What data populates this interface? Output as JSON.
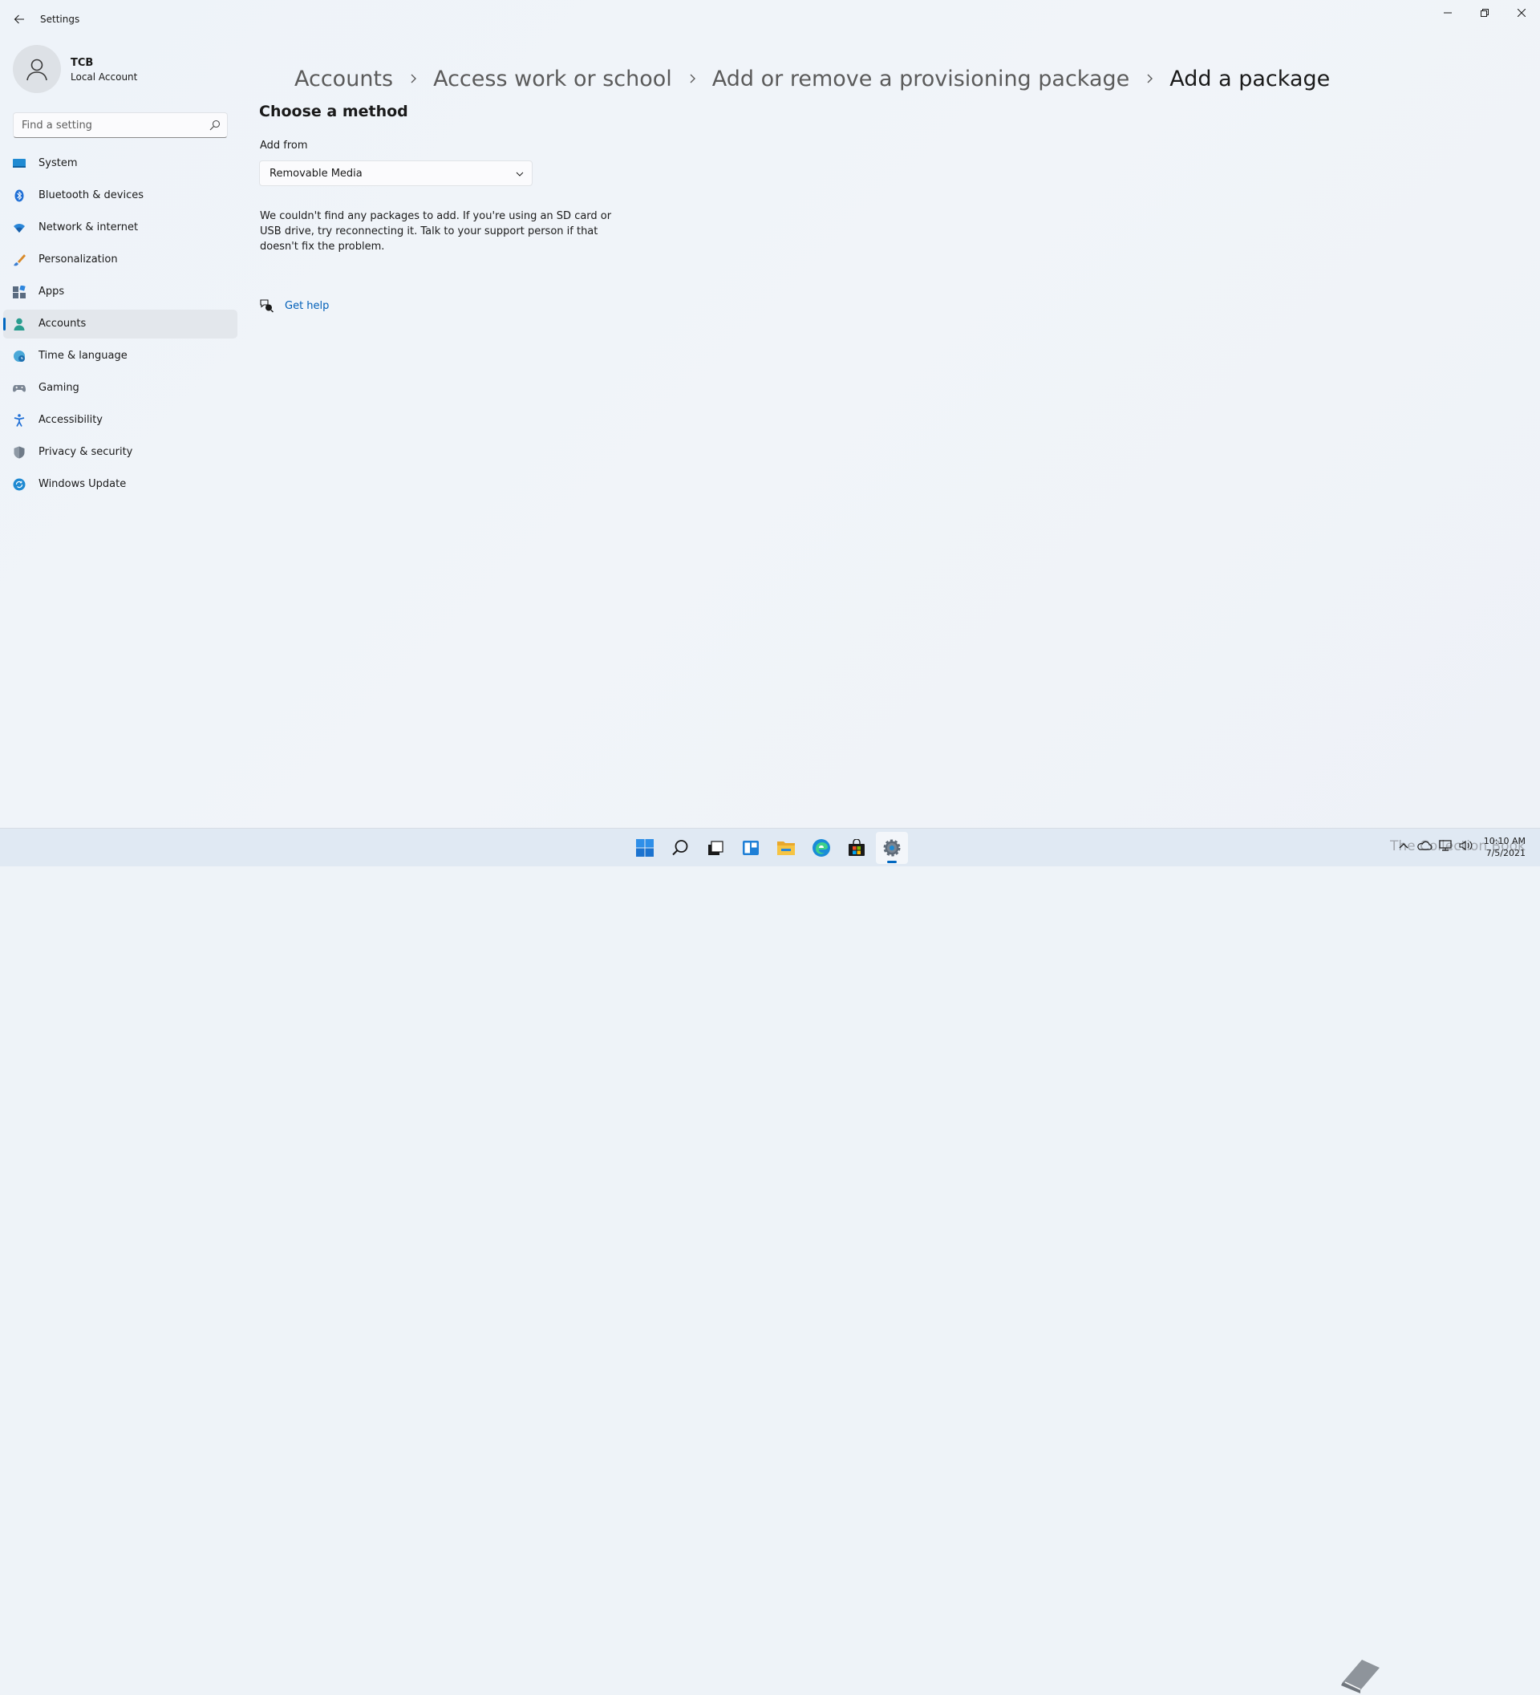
{
  "app": {
    "title": "Settings"
  },
  "profile": {
    "name": "TCB",
    "subtitle": "Local Account"
  },
  "search": {
    "placeholder": "Find a setting"
  },
  "nav": {
    "items": [
      {
        "label": "System",
        "icon": "monitor-icon"
      },
      {
        "label": "Bluetooth & devices",
        "icon": "bluetooth-icon"
      },
      {
        "label": "Network & internet",
        "icon": "wifi-icon"
      },
      {
        "label": "Personalization",
        "icon": "brush-icon"
      },
      {
        "label": "Apps",
        "icon": "apps-icon"
      },
      {
        "label": "Accounts",
        "icon": "person-icon",
        "active": true
      },
      {
        "label": "Time & language",
        "icon": "globe-clock-icon"
      },
      {
        "label": "Gaming",
        "icon": "gamepad-icon"
      },
      {
        "label": "Accessibility",
        "icon": "accessibility-icon"
      },
      {
        "label": "Privacy & security",
        "icon": "shield-icon"
      },
      {
        "label": "Windows Update",
        "icon": "update-icon"
      }
    ]
  },
  "breadcrumb": {
    "items": [
      "Accounts",
      "Access work or school",
      "Add or remove a provisioning package",
      "Add a package"
    ]
  },
  "main": {
    "section_title": "Choose a method",
    "field_label": "Add from",
    "dropdown_value": "Removable Media",
    "message": "We couldn't find any packages to add. If you're using an SD card or USB drive, try reconnecting it. Talk to your support person if that doesn't fix the problem.",
    "help_link": "Get help"
  },
  "taskbar": {
    "watermark": "The Collection Book",
    "time": "10:10 AM",
    "date": "7/5/2021"
  },
  "colors": {
    "accent": "#0067c0",
    "link": "#005fb8"
  }
}
